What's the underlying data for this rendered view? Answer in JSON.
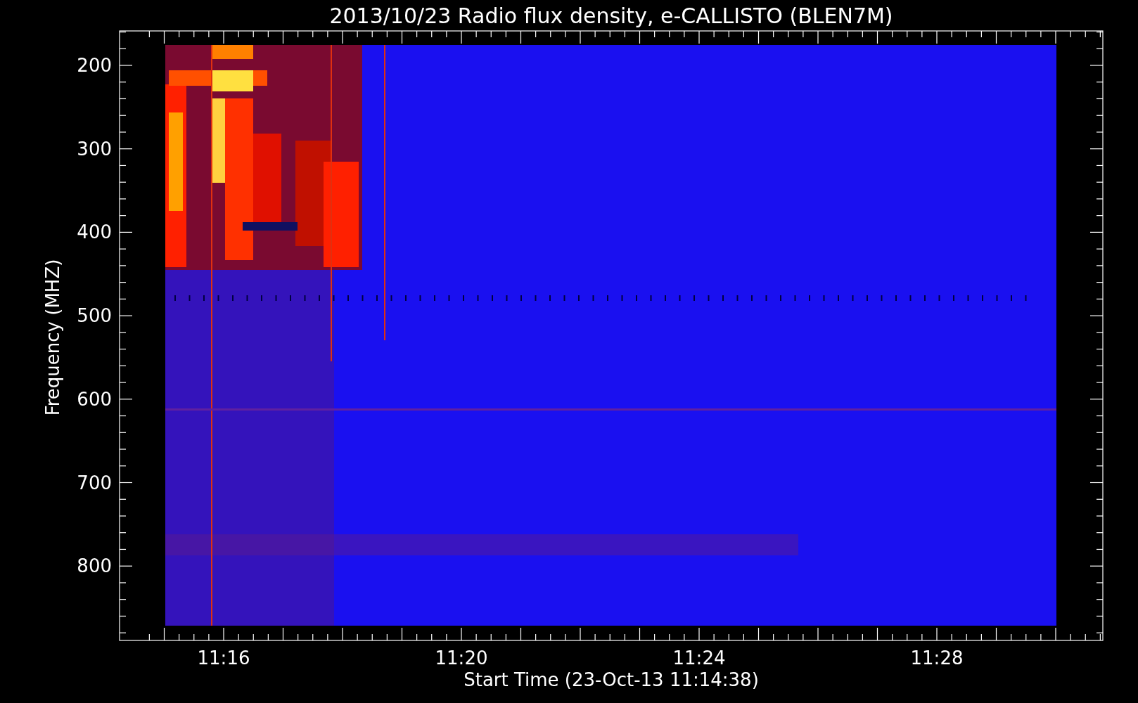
{
  "title": "2013/10/23  Radio flux density, e-CALLISTO (BLEN7M)",
  "y_axis": {
    "label": "Frequency (MHZ)",
    "ticks": [
      "200",
      "300",
      "400",
      "500",
      "600",
      "700",
      "800"
    ]
  },
  "x_axis": {
    "label": "Start Time (23-Oct-13 11:14:38)",
    "ticks": [
      "11:16",
      "11:20",
      "11:24",
      "11:28"
    ]
  }
}
